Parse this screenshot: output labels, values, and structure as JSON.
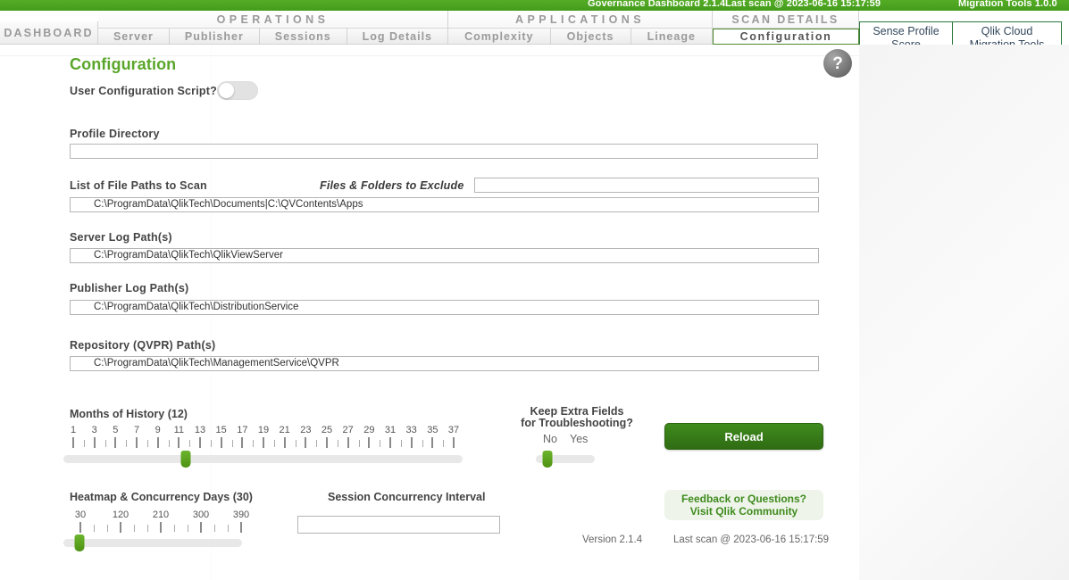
{
  "topbar": {
    "product_title": "Governance Dashboard 2.1.4",
    "last_scan": "Last scan @ 2023-06-16 15:17:59",
    "migration_tools": "Migration Tools 1.0.0",
    "accent_color": "#4aa521"
  },
  "nav": {
    "dashboard_label": "DASHBOARD",
    "groups": [
      {
        "title": "OPERATIONS",
        "items": [
          {
            "label": "Server",
            "selected": false
          },
          {
            "label": "Publisher",
            "selected": false
          },
          {
            "label": "Sessions",
            "selected": false
          },
          {
            "label": "Log Details",
            "selected": false
          }
        ]
      },
      {
        "title": "APPLICATIONS",
        "items": [
          {
            "label": "Complexity",
            "selected": false
          },
          {
            "label": "Objects",
            "selected": false
          },
          {
            "label": "Lineage",
            "selected": false
          }
        ]
      },
      {
        "title": "SCAN DETAILS",
        "items": [
          {
            "label": "Configuration",
            "selected": true
          }
        ]
      }
    ],
    "right_buttons": [
      {
        "line1": "Sense Profile",
        "line2": "Score"
      },
      {
        "line1": "Qlik Cloud",
        "line2": "Migration Tools"
      }
    ]
  },
  "page": {
    "title": "Configuration",
    "title_color": "#5aa62b",
    "help_icon": "question-mark"
  },
  "form": {
    "user_config_script": {
      "label": "User Configuration Script?",
      "value": "off"
    },
    "profile_directory": {
      "label": "Profile Directory",
      "value": "",
      "placeholder": ""
    },
    "file_paths_to_scan": {
      "label": "List of File Paths to Scan",
      "value": "C:\\ProgramData\\QlikTech\\Documents|C:\\QVContents\\Apps"
    },
    "files_folders_to_exclude": {
      "label": "Files & Folders to Exclude",
      "value": "",
      "placeholder": ""
    },
    "server_log_paths": {
      "label": "Server Log Path(s)",
      "value": "C:\\ProgramData\\QlikTech\\QlikViewServer"
    },
    "publisher_log_paths": {
      "label": "Publisher Log Path(s)",
      "value": "C:\\ProgramData\\QlikTech\\DistributionService"
    },
    "repository_paths": {
      "label": "Repository (QVPR) Path(s)",
      "value": "C:\\ProgramData\\QlikTech\\ManagementService\\QVPR"
    },
    "session_concurrency_interval": {
      "label": "Session Concurrency Interval",
      "value": "",
      "placeholder": ""
    }
  },
  "sliders": {
    "months_of_history": {
      "label": "Months of History (12)",
      "value": 12,
      "min": 1,
      "max": 37,
      "tick_labels": [
        "1",
        "3",
        "5",
        "7",
        "9",
        "11",
        "13",
        "15",
        "17",
        "19",
        "21",
        "23",
        "25",
        "27",
        "29",
        "31",
        "33",
        "35",
        "37"
      ]
    },
    "keep_extra_fields": {
      "label_line1": "Keep Extra Fields",
      "label_line2": "for Troubleshooting?",
      "options": [
        "No",
        "Yes"
      ],
      "value": "No"
    },
    "heatmap_concurrency_days": {
      "label": "Heatmap & Concurrency Days (30)",
      "value": 30,
      "min": 30,
      "max": 420,
      "tick_labels": [
        "30",
        "120",
        "210",
        "300",
        "390"
      ]
    }
  },
  "actions": {
    "reload_label": "Reload",
    "feedback_line1": "Feedback or Questions?",
    "feedback_line2": "Visit Qlik Community"
  },
  "footer": {
    "version": "Version 2.1.4",
    "last_scan": "Last scan @ 2023-06-16 15:17:59"
  }
}
